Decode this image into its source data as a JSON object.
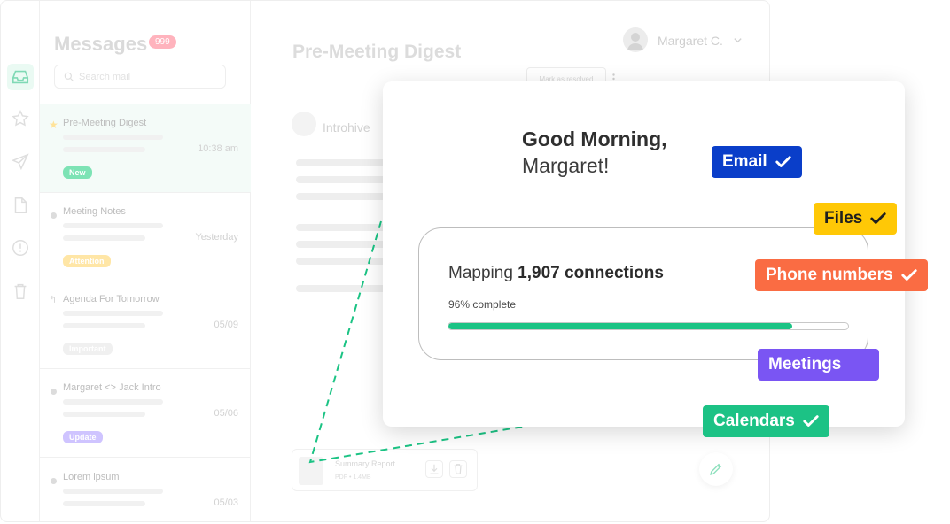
{
  "messages_panel": {
    "title": "Messages",
    "unread_count": "999",
    "search_placeholder": "Search mail",
    "items": [
      {
        "subject": "Pre-Meeting Digest",
        "time": "10:38 am",
        "tag": "New",
        "tag_color": "#7de3b5"
      },
      {
        "subject": "Meeting Notes",
        "time": "Yesterday",
        "tag": "Attention",
        "tag_color": "#ffe6a6"
      },
      {
        "subject": "Agenda For Tomorrow",
        "time": "05/09",
        "tag": "Important",
        "tag_color": "#f0f0f0"
      },
      {
        "subject": "Margaret <> Jack Intro",
        "time": "05/06",
        "tag": "Update",
        "tag_color": "#cfc4ff"
      },
      {
        "subject": "Lorem ipsum",
        "time": "05/03"
      }
    ]
  },
  "main": {
    "title": "Pre-Meeting Digest",
    "user_name": "Margaret C.",
    "resolve_label": "Mark as resolved",
    "sender": "Introhive",
    "attachment": {
      "name": "Summary Report",
      "meta": "PDF • 1.4MB"
    }
  },
  "card": {
    "greeting": "Good Morning,",
    "name": "Margaret!",
    "mapping_prefix": "Mapping",
    "mapping_count": "1,907 connections",
    "percent_text": "96% complete",
    "progress_fraction": 0.86
  },
  "tags": [
    {
      "label": "Email",
      "color": "#0a3ec9",
      "checked": true
    },
    {
      "label": "Files",
      "color": "#ffc806",
      "checked": true
    },
    {
      "label": "Phone numbers",
      "color": "#fa6c43",
      "checked": true
    },
    {
      "label": "Meetings",
      "color": "#7a55f3",
      "checked": false
    },
    {
      "label": "Calendars",
      "color": "#1cc285",
      "checked": true
    }
  ],
  "colors": {
    "accent": "#1bc384",
    "connector": "#1bc384"
  }
}
